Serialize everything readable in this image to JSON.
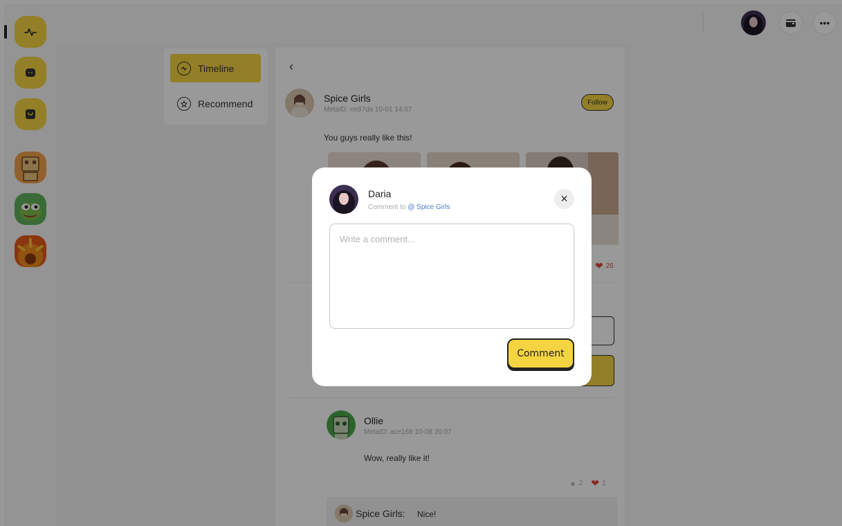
{
  "sidebar": {
    "icons": [
      "activity-icon",
      "chat-icon",
      "bag-icon"
    ],
    "apps": [
      "robot-app-icon",
      "pepe-app-icon",
      "flower-app-icon"
    ]
  },
  "tabs": {
    "items": [
      {
        "label": "Timeline",
        "icon": "activity-icon",
        "active": true
      },
      {
        "label": "Recommend",
        "icon": "star-icon",
        "active": false
      }
    ]
  },
  "post": {
    "author": "Spice Girls",
    "meta": "MetaID: ee87da 10-01 14:07",
    "follow_label": "Follow",
    "text": "You guys really like this!",
    "likes": "26"
  },
  "comment": {
    "author": "Ollie",
    "meta": "MetaID: ace168 10-08 20:07",
    "text": "Wow, really like it!",
    "replies": "2",
    "likes": "1",
    "reply": {
      "author": "Spice Girls:",
      "text": "Nice!"
    }
  },
  "modal": {
    "user": "Daria",
    "comment_to": "Comment to",
    "mention": "@ Spice Girls",
    "placeholder": "Write a comment...",
    "submit_label": "Comment"
  },
  "colors": {
    "accent": "#f5d442",
    "like": "#e04a3f",
    "link": "#4a7ec7"
  }
}
